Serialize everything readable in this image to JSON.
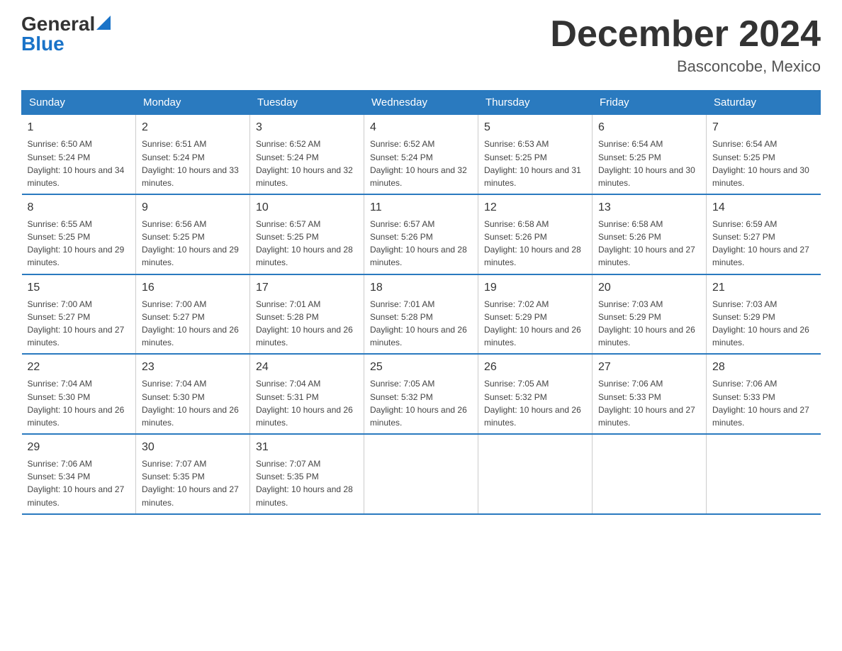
{
  "logo": {
    "general": "General",
    "blue": "Blue"
  },
  "title": "December 2024",
  "subtitle": "Basconcobe, Mexico",
  "days_of_week": [
    "Sunday",
    "Monday",
    "Tuesday",
    "Wednesday",
    "Thursday",
    "Friday",
    "Saturday"
  ],
  "weeks": [
    [
      {
        "day": "1",
        "sunrise": "6:50 AM",
        "sunset": "5:24 PM",
        "daylight": "10 hours and 34 minutes."
      },
      {
        "day": "2",
        "sunrise": "6:51 AM",
        "sunset": "5:24 PM",
        "daylight": "10 hours and 33 minutes."
      },
      {
        "day": "3",
        "sunrise": "6:52 AM",
        "sunset": "5:24 PM",
        "daylight": "10 hours and 32 minutes."
      },
      {
        "day": "4",
        "sunrise": "6:52 AM",
        "sunset": "5:24 PM",
        "daylight": "10 hours and 32 minutes."
      },
      {
        "day": "5",
        "sunrise": "6:53 AM",
        "sunset": "5:25 PM",
        "daylight": "10 hours and 31 minutes."
      },
      {
        "day": "6",
        "sunrise": "6:54 AM",
        "sunset": "5:25 PM",
        "daylight": "10 hours and 30 minutes."
      },
      {
        "day": "7",
        "sunrise": "6:54 AM",
        "sunset": "5:25 PM",
        "daylight": "10 hours and 30 minutes."
      }
    ],
    [
      {
        "day": "8",
        "sunrise": "6:55 AM",
        "sunset": "5:25 PM",
        "daylight": "10 hours and 29 minutes."
      },
      {
        "day": "9",
        "sunrise": "6:56 AM",
        "sunset": "5:25 PM",
        "daylight": "10 hours and 29 minutes."
      },
      {
        "day": "10",
        "sunrise": "6:57 AM",
        "sunset": "5:25 PM",
        "daylight": "10 hours and 28 minutes."
      },
      {
        "day": "11",
        "sunrise": "6:57 AM",
        "sunset": "5:26 PM",
        "daylight": "10 hours and 28 minutes."
      },
      {
        "day": "12",
        "sunrise": "6:58 AM",
        "sunset": "5:26 PM",
        "daylight": "10 hours and 28 minutes."
      },
      {
        "day": "13",
        "sunrise": "6:58 AM",
        "sunset": "5:26 PM",
        "daylight": "10 hours and 27 minutes."
      },
      {
        "day": "14",
        "sunrise": "6:59 AM",
        "sunset": "5:27 PM",
        "daylight": "10 hours and 27 minutes."
      }
    ],
    [
      {
        "day": "15",
        "sunrise": "7:00 AM",
        "sunset": "5:27 PM",
        "daylight": "10 hours and 27 minutes."
      },
      {
        "day": "16",
        "sunrise": "7:00 AM",
        "sunset": "5:27 PM",
        "daylight": "10 hours and 26 minutes."
      },
      {
        "day": "17",
        "sunrise": "7:01 AM",
        "sunset": "5:28 PM",
        "daylight": "10 hours and 26 minutes."
      },
      {
        "day": "18",
        "sunrise": "7:01 AM",
        "sunset": "5:28 PM",
        "daylight": "10 hours and 26 minutes."
      },
      {
        "day": "19",
        "sunrise": "7:02 AM",
        "sunset": "5:29 PM",
        "daylight": "10 hours and 26 minutes."
      },
      {
        "day": "20",
        "sunrise": "7:03 AM",
        "sunset": "5:29 PM",
        "daylight": "10 hours and 26 minutes."
      },
      {
        "day": "21",
        "sunrise": "7:03 AM",
        "sunset": "5:29 PM",
        "daylight": "10 hours and 26 minutes."
      }
    ],
    [
      {
        "day": "22",
        "sunrise": "7:04 AM",
        "sunset": "5:30 PM",
        "daylight": "10 hours and 26 minutes."
      },
      {
        "day": "23",
        "sunrise": "7:04 AM",
        "sunset": "5:30 PM",
        "daylight": "10 hours and 26 minutes."
      },
      {
        "day": "24",
        "sunrise": "7:04 AM",
        "sunset": "5:31 PM",
        "daylight": "10 hours and 26 minutes."
      },
      {
        "day": "25",
        "sunrise": "7:05 AM",
        "sunset": "5:32 PM",
        "daylight": "10 hours and 26 minutes."
      },
      {
        "day": "26",
        "sunrise": "7:05 AM",
        "sunset": "5:32 PM",
        "daylight": "10 hours and 26 minutes."
      },
      {
        "day": "27",
        "sunrise": "7:06 AM",
        "sunset": "5:33 PM",
        "daylight": "10 hours and 27 minutes."
      },
      {
        "day": "28",
        "sunrise": "7:06 AM",
        "sunset": "5:33 PM",
        "daylight": "10 hours and 27 minutes."
      }
    ],
    [
      {
        "day": "29",
        "sunrise": "7:06 AM",
        "sunset": "5:34 PM",
        "daylight": "10 hours and 27 minutes."
      },
      {
        "day": "30",
        "sunrise": "7:07 AM",
        "sunset": "5:35 PM",
        "daylight": "10 hours and 27 minutes."
      },
      {
        "day": "31",
        "sunrise": "7:07 AM",
        "sunset": "5:35 PM",
        "daylight": "10 hours and 28 minutes."
      },
      null,
      null,
      null,
      null
    ]
  ]
}
